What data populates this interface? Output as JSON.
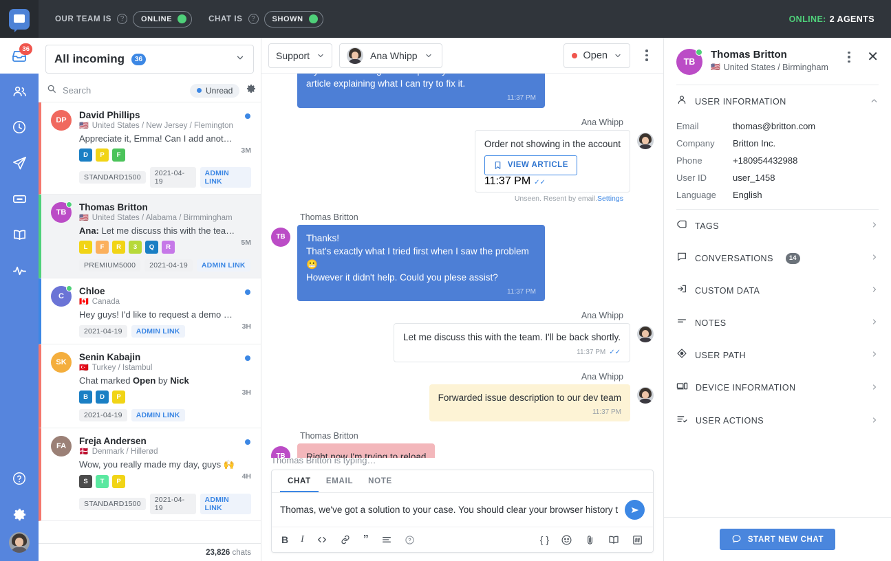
{
  "topbar": {
    "team_label": "OUR TEAM IS",
    "team_status": "ONLINE",
    "chat_label": "CHAT IS",
    "chat_status": "SHOWN",
    "online_label": "ONLINE:",
    "online_agents": "2 AGENTS",
    "accent_green": "#4fd07a"
  },
  "leftnav": {
    "items": [
      {
        "name": "inbox-icon",
        "badge": "36",
        "active": true
      },
      {
        "name": "contacts-icon",
        "badge": "",
        "active": false
      },
      {
        "name": "history-clock-icon",
        "badge": "",
        "active": false
      },
      {
        "name": "campaigns-send-icon",
        "badge": "",
        "active": false
      },
      {
        "name": "ticket-icon",
        "badge": "",
        "active": false
      },
      {
        "name": "knowledge-book-icon",
        "badge": "",
        "active": false
      },
      {
        "name": "reports-pulse-icon",
        "badge": "",
        "active": false
      }
    ],
    "bottom": [
      {
        "name": "help-icon"
      },
      {
        "name": "settings-gear-icon"
      }
    ]
  },
  "conversation_list": {
    "filter_title": "All incoming",
    "filter_count": "36",
    "search_placeholder": "Search",
    "unread_label": "Unread",
    "footer_count": "23,826",
    "footer_suffix": "chats",
    "items": [
      {
        "name": "David Phillips",
        "initials": "DP",
        "avatar_color": "#f0695f",
        "bar_color": "#f4776d",
        "location": "United States / New Jersey / Flemington",
        "flag": "🇺🇸",
        "preview": "Appreciate it, Emma! Can I add anothe…",
        "preview_prefix": "",
        "time": "3M",
        "unread": true,
        "online": false,
        "selected": false,
        "tags": [
          {
            "letter": "D",
            "color": "#1a7fc4"
          },
          {
            "letter": "P",
            "color": "#f1d416"
          },
          {
            "letter": "F",
            "color": "#4bc35a"
          }
        ],
        "meta": [
          "STANDARD1500",
          "2021-04-19"
        ],
        "admin_link": "ADMIN LINK"
      },
      {
        "name": "Thomas Britton",
        "initials": "TB",
        "avatar_color": "#bb4cc6",
        "bar_color": "#4fd07a",
        "location": "United States / Alabama / Birmmingham",
        "flag": "🇺🇸",
        "preview": "Let me discuss this with the team…",
        "preview_prefix": "Ana:",
        "time": "5M",
        "unread": false,
        "online": true,
        "selected": true,
        "tags": [
          {
            "letter": "L",
            "color": "#f1d416"
          },
          {
            "letter": "F",
            "color": "#fbb05c"
          },
          {
            "letter": "R",
            "color": "#f1d416"
          },
          {
            "letter": "3",
            "color": "#b7d93a"
          },
          {
            "letter": "Q",
            "color": "#1a7fc4"
          },
          {
            "letter": "R",
            "color": "#c678e8"
          }
        ],
        "meta": [
          "PREMIUM5000",
          "2021-04-19"
        ],
        "admin_link": "ADMIN LINK"
      },
      {
        "name": "Chloe",
        "initials": "C",
        "avatar_color": "#6b74d6",
        "bar_color": "#3c87e4",
        "location": "Canada",
        "flag": "🇨🇦",
        "preview": "Hey guys! I'd like to request a demo of…",
        "preview_prefix": "",
        "time": "3H",
        "unread": true,
        "online": true,
        "selected": false,
        "tags": [],
        "meta": [
          "2021-04-19"
        ],
        "admin_link": "ADMIN LINK"
      },
      {
        "name": "Senin Kabajin",
        "initials": "SK",
        "avatar_color": "#f4ae3d",
        "bar_color": "#f4776d",
        "location": "Turkey / Istambul",
        "flag": "🇹🇷",
        "preview": "Chat marked Open by Nick",
        "preview_prefix": "",
        "time": "3H",
        "unread": true,
        "online": false,
        "selected": false,
        "tags": [
          {
            "letter": "B",
            "color": "#1a7fc4"
          },
          {
            "letter": "D",
            "color": "#1a7fc4"
          },
          {
            "letter": "P",
            "color": "#f1d416"
          }
        ],
        "meta": [
          "2021-04-19"
        ],
        "admin_link": "ADMIN LINK"
      },
      {
        "name": "Freja Andersen",
        "initials": "FA",
        "avatar_color": "#9b8076",
        "bar_color": "#f4776d",
        "location": "Denmark / Hillerød",
        "flag": "🇩🇰",
        "preview": "Wow, you really made my day, guys 🙌",
        "preview_prefix": "",
        "time": "4H",
        "unread": true,
        "online": false,
        "selected": false,
        "tags": [
          {
            "letter": "S",
            "color": "#4b4b4b"
          },
          {
            "letter": "T",
            "color": "#5ae8a0"
          },
          {
            "letter": "P",
            "color": "#f1d416"
          }
        ],
        "meta": [
          "STANDARD1500",
          "2021-04-19"
        ],
        "admin_link": "ADMIN LINK"
      }
    ]
  },
  "chat": {
    "group_selector": "Support",
    "agent_selector": "Ana Whipp",
    "status_selector": "Open",
    "typing_indicator": "Thomas Britton is typing…",
    "messages": [
      {
        "kind": "incoming-bubble",
        "sender": "",
        "initials": "TB",
        "avatar_color": "#bb4cc6",
        "text": "I just placed the order, however it doesn't show up in my account. It might be helpful if you send me over that article explaining what I can try to fix it.",
        "time": "11:37 PM",
        "read": false
      },
      {
        "kind": "article-card",
        "sender": "Ana Whipp",
        "article_title": "Order not showing in the account",
        "article_button": "VIEW ARTICLE",
        "time": "11:37 PM",
        "read": true,
        "footnote": "Unseen. Resent by email.",
        "footnote_link": "Settings"
      },
      {
        "kind": "incoming-bubble",
        "sender": "Thomas Britton",
        "initials": "TB",
        "avatar_color": "#bb4cc6",
        "text": "Thanks!\nThat's exactly what I tried first when I saw the problem 😬\nHowever it didn't help. Could you plese assist?",
        "time": "11:37 PM",
        "read": false
      },
      {
        "kind": "agent-bubble",
        "sender": "Ana Whipp",
        "text": "Let me discuss this with the team. I'll be back shortly.",
        "time": "11:37 PM",
        "read": true
      },
      {
        "kind": "note-bubble",
        "sender": "Ana Whipp",
        "text": "Forwarded issue description to our dev team",
        "time": "11:37 PM",
        "read": false
      },
      {
        "kind": "draft-bubble",
        "sender": "Thomas Britton",
        "initials": "TB",
        "avatar_color": "#bb4cc6",
        "text": "Right now I'm trying to reload",
        "time": "",
        "read": false
      }
    ],
    "composer": {
      "tabs": [
        "CHAT",
        "EMAIL",
        "NOTE"
      ],
      "active_tab": "CHAT",
      "value": "Thomas, we've got a solution to your case. You should clear your browser history toget",
      "tools_left": [
        "bold-icon",
        "italic-icon",
        "code-icon",
        "link-icon",
        "quote-icon",
        "list-icon",
        "help-icon"
      ],
      "tools_right": [
        "canned-braces-icon",
        "emoji-icon",
        "attachment-icon",
        "knowledge-book-icon",
        "tag-icon"
      ],
      "send_icon": "send-icon"
    }
  },
  "right_panel": {
    "user_name": "Thomas Britton",
    "user_location": "United States / Birmingham",
    "user_flag": "🇺🇸",
    "user_initials": "TB",
    "user_info_header": "USER INFORMATION",
    "info": [
      {
        "key": "Email",
        "value": "thomas@britton.com"
      },
      {
        "key": "Company",
        "value": "Britton Inc."
      },
      {
        "key": "Phone",
        "value": "+180954432988"
      },
      {
        "key": "User ID",
        "value": "user_1458"
      },
      {
        "key": "Language",
        "value": "English"
      }
    ],
    "sections": [
      {
        "label": "TAGS",
        "icon": "tag-icon",
        "badge": ""
      },
      {
        "label": "CONVERSATIONS",
        "icon": "conversation-icon",
        "badge": "14"
      },
      {
        "label": "CUSTOM DATA",
        "icon": "custom-data-icon",
        "badge": ""
      },
      {
        "label": "NOTES",
        "icon": "notes-icon",
        "badge": ""
      },
      {
        "label": "USER PATH",
        "icon": "user-path-icon",
        "badge": ""
      },
      {
        "label": "DEVICE INFORMATION",
        "icon": "device-icon",
        "badge": ""
      },
      {
        "label": "USER ACTIONS",
        "icon": "user-actions-icon",
        "badge": ""
      }
    ],
    "start_chat_label": "START NEW CHAT"
  }
}
